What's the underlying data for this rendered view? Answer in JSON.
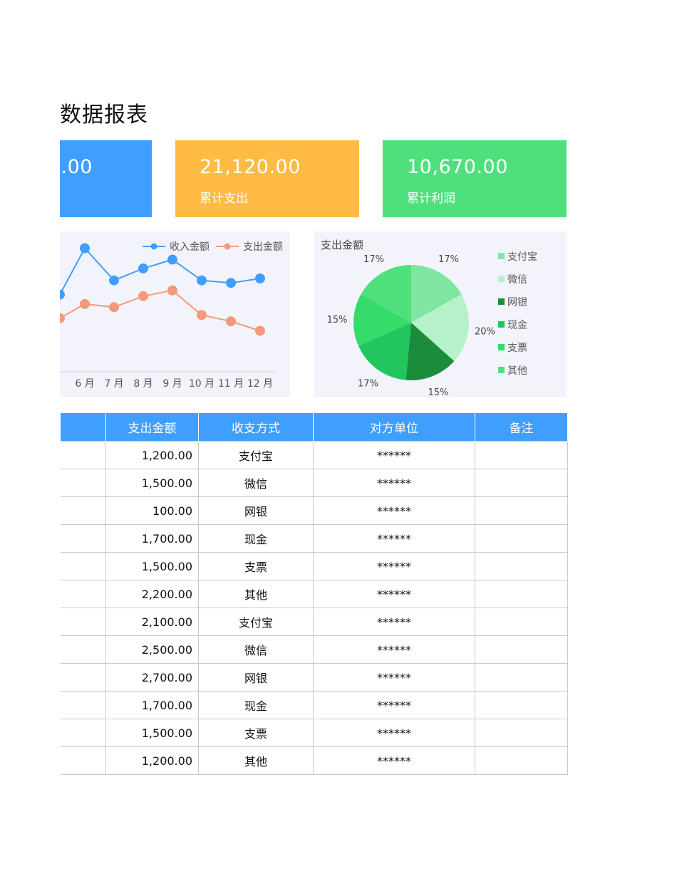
{
  "page": {
    "title": "数据报表"
  },
  "cards": [
    {
      "value": ".00",
      "label": ""
    },
    {
      "value": "21,120.00",
      "label": "累计支出"
    },
    {
      "value": "10,670.00",
      "label": "累计利润"
    }
  ],
  "colors": {
    "blue": "#409EFF",
    "orange": "#FFBB44",
    "green": "#4FE07D",
    "income_line": "#409EFF",
    "expense_line": "#F39A7B"
  },
  "chart_data": [
    {
      "type": "line",
      "title": "",
      "categories": [
        "月",
        "6 月",
        "7 月",
        "8 月",
        "9 月",
        "10 月",
        "11 月",
        "12 月"
      ],
      "series": [
        {
          "name": "收入金额",
          "values": [
            2450,
            3920,
            2900,
            3280,
            3560,
            2900,
            2820,
            2960
          ]
        },
        {
          "name": "支出金额",
          "values": [
            1700,
            2150,
            2050,
            2400,
            2580,
            1800,
            1600,
            1300
          ]
        }
      ],
      "legend": "top-right",
      "ylim": [
        0,
        4000
      ]
    },
    {
      "type": "pie",
      "title": "支出金额",
      "categories": [
        "支付宝",
        "微信",
        "网银",
        "现金",
        "支票",
        "其他"
      ],
      "values": [
        17,
        20,
        15,
        17,
        15,
        17
      ],
      "labels": [
        "17%",
        "20%",
        "15%",
        "17%",
        "15%",
        "17%"
      ],
      "colors": [
        "#7EE6A0",
        "#B6F2C9",
        "#1A8C3C",
        "#22C55E",
        "#35DC6A",
        "#4FE07D"
      ],
      "legend": "right"
    }
  ],
  "table": {
    "headers": [
      "",
      "支出金额",
      "收支方式",
      "对方单位",
      "备注"
    ],
    "rows": [
      [
        "",
        "1,200.00",
        "支付宝",
        "******",
        ""
      ],
      [
        "",
        "1,500.00",
        "微信",
        "******",
        ""
      ],
      [
        "",
        "100.00",
        "网银",
        "******",
        ""
      ],
      [
        "",
        "1,700.00",
        "现金",
        "******",
        ""
      ],
      [
        "",
        "1,500.00",
        "支票",
        "******",
        ""
      ],
      [
        "",
        "2,200.00",
        "其他",
        "******",
        ""
      ],
      [
        "",
        "2,100.00",
        "支付宝",
        "******",
        ""
      ],
      [
        "",
        "2,500.00",
        "微信",
        "******",
        ""
      ],
      [
        "",
        "2,700.00",
        "网银",
        "******",
        ""
      ],
      [
        "",
        "1,700.00",
        "现金",
        "******",
        ""
      ],
      [
        "",
        "1,500.00",
        "支票",
        "******",
        ""
      ],
      [
        "",
        "1,200.00",
        "其他",
        "******",
        ""
      ]
    ]
  }
}
